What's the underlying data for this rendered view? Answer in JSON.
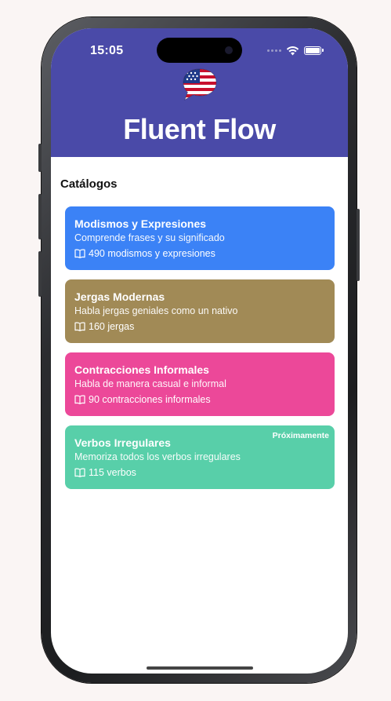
{
  "status_bar": {
    "time": "15:05"
  },
  "header": {
    "app_title": "Fluent Flow",
    "background_color": "#4a4aa8",
    "logo_icon": "us-flag-chat-bubble-icon"
  },
  "section_title": "Catálogos",
  "catalogs": [
    {
      "title": "Modismos y Expresiones",
      "subtitle": "Comprende frases y su significado",
      "count": "490 modismos y expresiones",
      "color": "#3b82f6",
      "badge": ""
    },
    {
      "title": "Jergas Modernas",
      "subtitle": "Habla jergas geniales como un nativo",
      "count": "160 jergas",
      "color": "#a18a56",
      "badge": ""
    },
    {
      "title": "Contracciones Informales",
      "subtitle": "Habla de manera casual e informal",
      "count": "90 contracciones informales",
      "color": "#ec4899",
      "badge": ""
    },
    {
      "title": "Verbos Irregulares",
      "subtitle": "Memoriza todos los verbos irregulares",
      "count": "115 verbos",
      "color": "#58cfa9",
      "badge": "Próximamente"
    }
  ]
}
